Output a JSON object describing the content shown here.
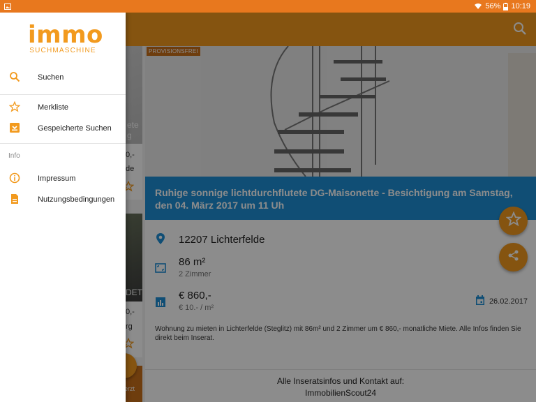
{
  "statusbar": {
    "battery": "56%",
    "time": "10:19"
  },
  "drawer": {
    "logo_word": "immo",
    "logo_sub": "SUCHMASCHINE",
    "items": [
      {
        "label": "Suchen",
        "icon": "search-icon"
      },
      {
        "label": "Merkliste",
        "icon": "star-icon"
      },
      {
        "label": "Gespeicherte Suchen",
        "icon": "save-icon"
      }
    ],
    "info_section": "Info",
    "info_items": [
      {
        "label": "Impressum",
        "icon": "info-icon"
      },
      {
        "label": "Nutzungsbedingungen",
        "icon": "document-icon"
      }
    ]
  },
  "background_list": {
    "card1_texts": [
      "ete",
      "g",
      "0,-",
      "de"
    ],
    "card2_texts": [
      "DET",
      "0,-",
      "rg"
    ],
    "card3_text": "erzt"
  },
  "detail": {
    "badge": "PROVISIONSFREI",
    "title": "Ruhige sonnige lichtdurchflutete DG-Maisonette - Besichtigung am Samstag, den 04. März 2017 um 11 Uh",
    "location": "12207 Lichterfelde",
    "area": "86 m²",
    "rooms": "2 Zimmer",
    "price": "€ 860,-",
    "price_per_sqm": "€ 10.- / m²",
    "date": "26.02.2017",
    "description": "Wohnung zu mieten in Lichterfelde (Steglitz) mit 86m² und 2 Zimmer um € 860,- monatliche Miete. Alle Infos finden Sie direkt beim Inserat.",
    "footer_line1": "Alle Inseratsinfos und Kontakt auf:",
    "footer_line2": "ImmobilienScout24"
  },
  "colors": {
    "orange": "#f29a1e",
    "statusbar": "#e8781e",
    "blue": "#1e8fd6"
  }
}
